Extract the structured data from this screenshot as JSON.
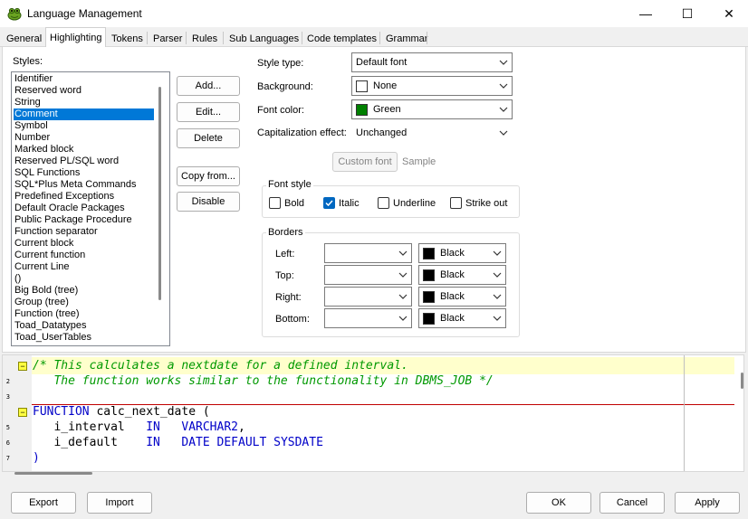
{
  "window": {
    "title": "Language Management",
    "minimize_label": "—",
    "maximize_label": "☐",
    "close_label": "✕"
  },
  "tabs": [
    {
      "label": "General"
    },
    {
      "label": "Highlighting",
      "active": true
    },
    {
      "label": "Tokens"
    },
    {
      "label": "Parser"
    },
    {
      "label": "Rules"
    },
    {
      "label": "Sub Languages"
    },
    {
      "label": "Code templates"
    },
    {
      "label": "Grammar"
    }
  ],
  "styles": {
    "label": "Styles:",
    "items": [
      "Identifier",
      "Reserved word",
      "String",
      "Comment",
      "Symbol",
      "Number",
      "Marked block",
      "Reserved PL/SQL word",
      "SQL Functions",
      "SQL*Plus Meta Commands",
      "Predefined Exceptions",
      "Default Oracle Packages",
      "Public Package Procedure",
      "Function separator",
      "Current block",
      "Current function",
      "Current Line",
      "()",
      "Big Bold (tree)",
      "Group (tree)",
      "Function (tree)",
      "Toad_Datatypes",
      "Toad_UserTables"
    ],
    "selected_index": 3
  },
  "buttons": {
    "add": "Add...",
    "edit": "Edit...",
    "delete": "Delete",
    "copy_from": "Copy from...",
    "disable": "Disable"
  },
  "properties": {
    "style_type": {
      "label": "Style type:",
      "value": "Default font"
    },
    "background": {
      "label": "Background:",
      "value": "None",
      "swatch": "#ffffff"
    },
    "font_color": {
      "label": "Font color:",
      "value": "Green",
      "swatch": "#008000"
    },
    "capitalization": {
      "label": "Capitalization effect:",
      "value": "Unchanged"
    },
    "custom_font": "Custom font",
    "sample": "Sample"
  },
  "font_style": {
    "title": "Font style",
    "bold": {
      "label": "Bold",
      "checked": false
    },
    "italic": {
      "label": "Italic",
      "checked": true
    },
    "underline": {
      "label": "Underline",
      "checked": false
    },
    "strike_out": {
      "label": "Strike out",
      "checked": false
    }
  },
  "borders": {
    "title": "Borders",
    "rows": [
      {
        "label": "Left:",
        "style": "",
        "color": "Black"
      },
      {
        "label": "Top:",
        "style": "",
        "color": "Black"
      },
      {
        "label": "Right:",
        "style": "",
        "color": "Black"
      },
      {
        "label": "Bottom:",
        "style": "",
        "color": "Black"
      }
    ],
    "swatch": "#000000"
  },
  "editor": {
    "line_numbers": [
      "2",
      "3",
      "5",
      "6",
      "7"
    ],
    "lines": [
      {
        "parts": [
          {
            "t": "/* This calculates a nextdate for a defined interval.",
            "c": "comment"
          }
        ]
      },
      {
        "parts": [
          {
            "t": "   The function works similar to the functionality in DBMS_JOB */",
            "c": "comment"
          }
        ]
      },
      {
        "parts": []
      },
      {
        "parts": [
          {
            "t": "FUNCTION",
            "c": "kw"
          },
          {
            "t": " calc_next_date (",
            "c": "plain"
          }
        ]
      },
      {
        "parts": [
          {
            "t": "   i_interval   ",
            "c": "plain"
          },
          {
            "t": "IN",
            "c": "kw"
          },
          {
            "t": "   ",
            "c": "plain"
          },
          {
            "t": "VARCHAR2",
            "c": "kw"
          },
          {
            "t": ",",
            "c": "plain"
          }
        ]
      },
      {
        "parts": [
          {
            "t": "   i_default    ",
            "c": "plain"
          },
          {
            "t": "IN",
            "c": "kw"
          },
          {
            "t": "   ",
            "c": "plain"
          },
          {
            "t": "DATE DEFAULT SYSDATE",
            "c": "kw"
          }
        ]
      },
      {
        "parts": [
          {
            "t": ")",
            "c": "kw"
          }
        ]
      }
    ],
    "fold_symbol": "−"
  },
  "footer": {
    "export": "Export",
    "import": "Import",
    "ok": "OK",
    "cancel": "Cancel",
    "apply": "Apply"
  }
}
